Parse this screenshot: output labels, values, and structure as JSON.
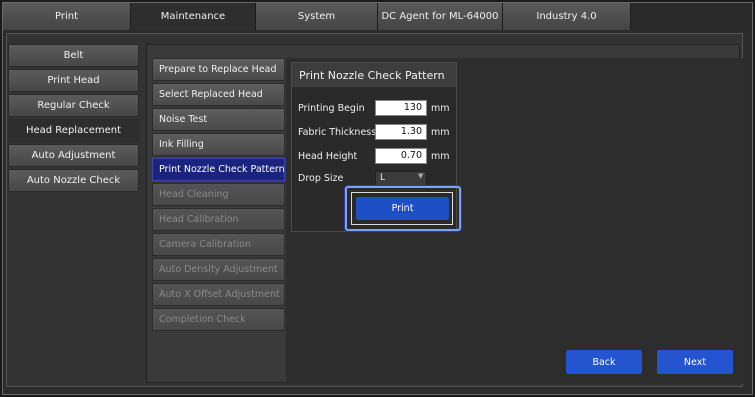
{
  "tabs": [
    "Print",
    "Maintenance",
    "System",
    "DC Agent for ML-64000",
    "Industry 4.0"
  ],
  "left_menu": [
    "Belt",
    "Print Head",
    "Regular Check",
    "Head Replacement",
    "Auto Adjustment",
    "Auto Nozzle Check"
  ],
  "steps": [
    "Prepare to Replace Head",
    "Select Replaced Head",
    "Noise Test",
    "Ink Filling",
    "Print Nozzle Check Pattern",
    "Head Cleaning",
    "Head Calibration",
    "Camera Calibration",
    "Auto Density Adjustment",
    "Auto X Offset Adjustment",
    "Completion Check"
  ],
  "card": {
    "title": "Print Nozzle Check Pattern",
    "fields": [
      {
        "label": "Printing Begin",
        "value": "130",
        "unit": "mm"
      },
      {
        "label": "Fabric Thickness",
        "value": "1.30",
        "unit": "mm"
      },
      {
        "label": "Head Height",
        "value": "0.70",
        "unit": "mm"
      }
    ],
    "drop_size_label": "Drop Size",
    "drop_size_value": "L",
    "print_button": "Print"
  },
  "nav": {
    "back": "Back",
    "next": "Next"
  },
  "colors": {
    "accent": "#1f4fc4",
    "current_step": "#1a237e",
    "highlight": "#7ea0ff"
  }
}
